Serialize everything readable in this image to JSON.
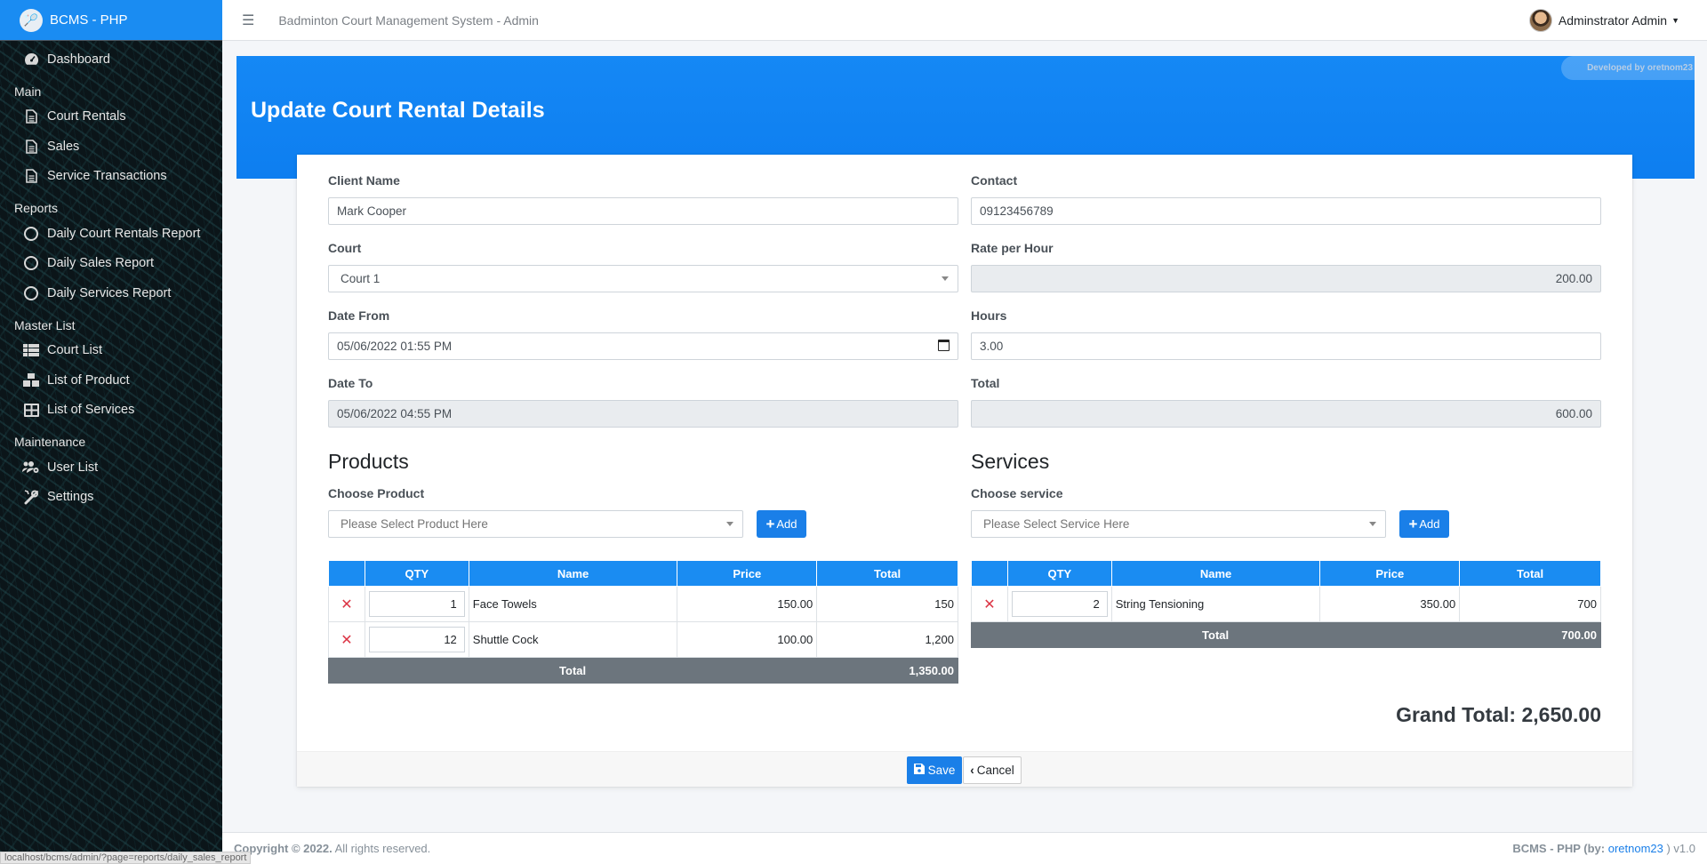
{
  "brand": {
    "title": "BCMS - PHP",
    "logo_icon": "badminton-logo-icon"
  },
  "topbar": {
    "system_title": "Badminton Court Management System - Admin",
    "user_name": "Adminstrator Admin"
  },
  "sidebar": {
    "dashboard": "Dashboard",
    "main_header": "Main",
    "main_items": [
      "Court Rentals",
      "Sales",
      "Service Transactions"
    ],
    "reports_header": "Reports",
    "report_items": [
      "Daily Court Rentals Report",
      "Daily Sales Report",
      "Daily Services Report"
    ],
    "master_header": "Master List",
    "master_items": [
      "Court List",
      "List of Product",
      "List of Services"
    ],
    "maintenance_header": "Maintenance",
    "maintenance_items": [
      "User List",
      "Settings"
    ]
  },
  "banner": {
    "title": "Update Court Rental Details",
    "developer_badge": "Developed by oretnom23"
  },
  "form": {
    "client_name_label": "Client Name",
    "client_name": "Mark Cooper",
    "contact_label": "Contact",
    "contact": "09123456789",
    "court_label": "Court",
    "court": "Court 1",
    "rate_label": "Rate per Hour",
    "rate": "200.00",
    "date_from_label": "Date From",
    "date_from": "05/06/2022 01:55 PM",
    "hours_label": "Hours",
    "hours": "3.00",
    "date_to_label": "Date To",
    "date_to": "05/06/2022 04:55 PM",
    "total_label": "Total",
    "total": "600.00"
  },
  "products": {
    "title": "Products",
    "choose_label": "Choose Product",
    "placeholder": "Please Select Product Here",
    "add_label": "Add",
    "headers": [
      "QTY",
      "Name",
      "Price",
      "Total"
    ],
    "rows": [
      {
        "qty": "1",
        "name": "Face Towels",
        "price": "150.00",
        "total": "150"
      },
      {
        "qty": "12",
        "name": "Shuttle Cock",
        "price": "100.00",
        "total": "1,200"
      }
    ],
    "total_label": "Total",
    "total": "1,350.00"
  },
  "services": {
    "title": "Services",
    "choose_label": "Choose service",
    "placeholder": "Please Select Service Here",
    "add_label": "Add",
    "headers": [
      "QTY",
      "Name",
      "Price",
      "Total"
    ],
    "rows": [
      {
        "qty": "2",
        "name": "String Tensioning",
        "price": "350.00",
        "total": "700"
      }
    ],
    "total_label": "Total",
    "total": "700.00"
  },
  "grand_total": "Grand Total: 2,650.00",
  "actions": {
    "save": "Save",
    "cancel": "Cancel"
  },
  "footer": {
    "copyright": "Copyright © 2022.",
    "rights": "All rights reserved.",
    "right_prefix": "BCMS - PHP (by: ",
    "author": "oretnom23",
    "right_suffix": " ) v1.0"
  },
  "status_url": "localhost/bcms/admin/?page=reports/daily_sales_report"
}
